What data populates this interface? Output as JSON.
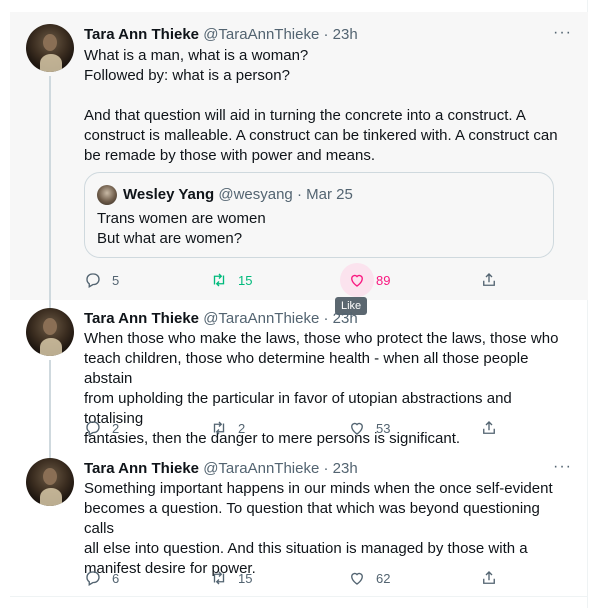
{
  "colors": {
    "retweet_active": "#00ba7c",
    "like_active": "#f91880",
    "muted": "#536471"
  },
  "tweets": [
    {
      "name": "Tara Ann Thieke",
      "handle": "@TaraAnnThieke",
      "dot": "·",
      "time": "23h",
      "more": "···",
      "lines": [
        "What is a man, what is a woman?",
        "Followed by: what is a person?",
        "",
        "And that question will aid in turning the concrete into a construct. A",
        "construct is malleable. A construct can be tinkered with. A construct can",
        "be remade by those with power and means."
      ],
      "quote": {
        "name": "Wesley Yang",
        "handle": "@wesyang",
        "dot": "·",
        "time": "Mar 25",
        "lines": [
          "Trans women are women",
          "But what are women?"
        ]
      },
      "replies": "5",
      "retweets": "15",
      "likes": "89",
      "tooltip": "Like"
    },
    {
      "name": "Tara Ann Thieke",
      "handle": "@TaraAnnThieke",
      "dot": "·",
      "time": "23h",
      "lines": [
        "When those who make the laws, those who protect the laws, those who",
        "teach children, those who determine health - when all those people abstain",
        "from upholding the particular in favor of utopian abstractions and totalising",
        "fantasies, then the danger to mere persons is significant."
      ],
      "replies": "2",
      "retweets": "2",
      "likes": "53"
    },
    {
      "name": "Tara Ann Thieke",
      "handle": "@TaraAnnThieke",
      "dot": "·",
      "time": "23h",
      "more": "···",
      "lines": [
        "Something important happens in our minds when the once self-evident",
        "becomes a question. To question that which was beyond questioning calls",
        "all else into question. And this situation is managed by those with a",
        "manifest desire for power."
      ],
      "replies": "6",
      "retweets": "15",
      "likes": "62"
    }
  ]
}
